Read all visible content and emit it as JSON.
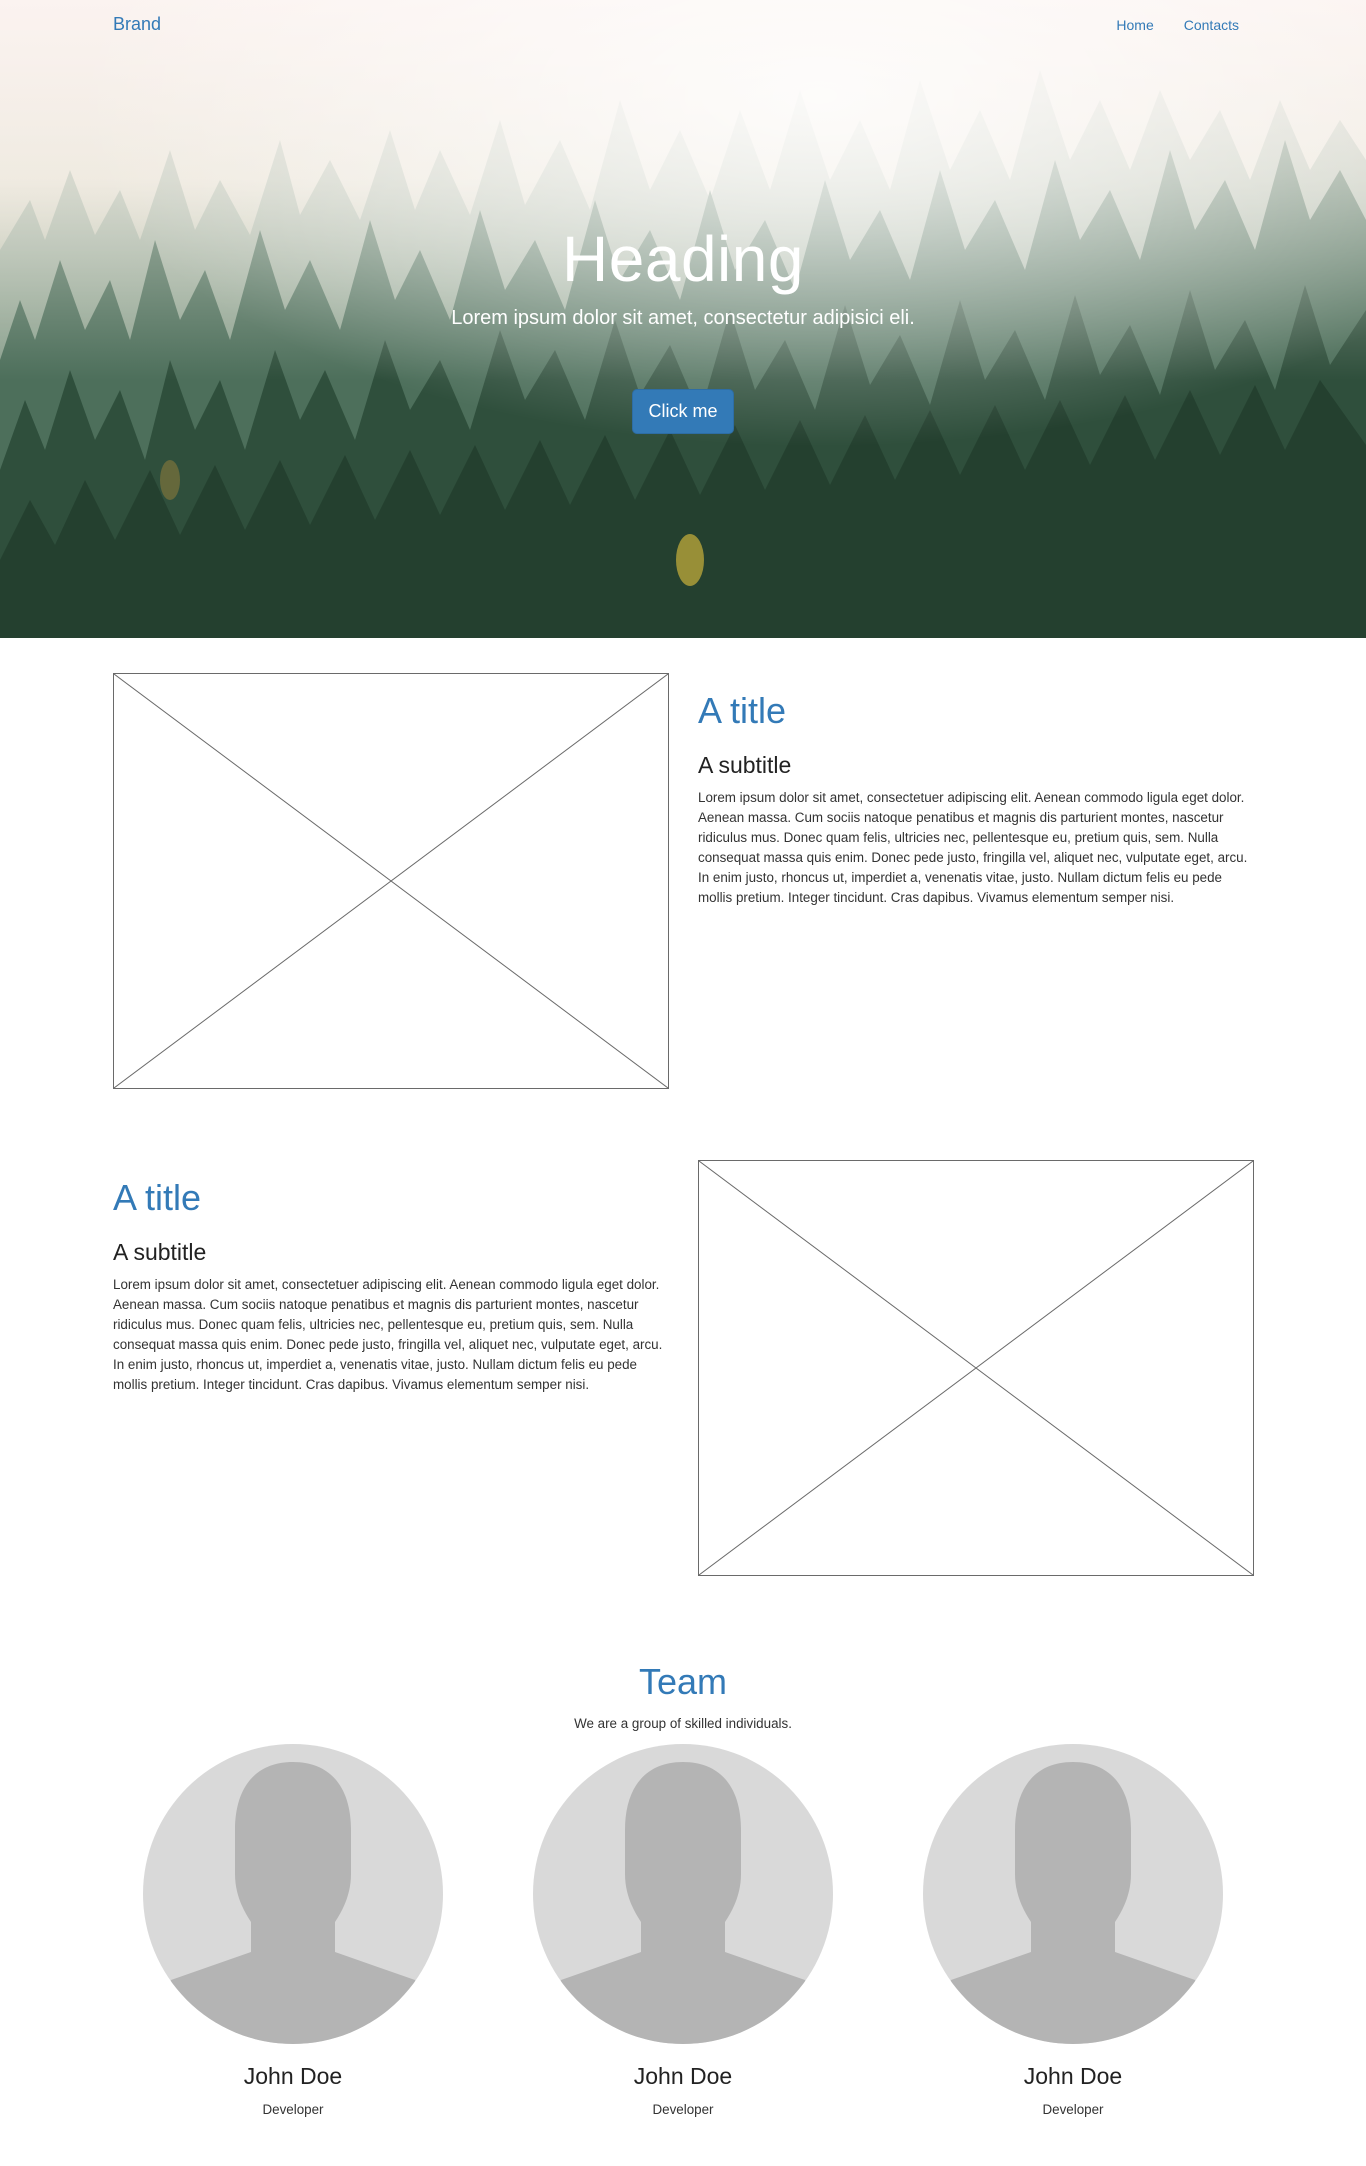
{
  "nav": {
    "brand": "Brand",
    "links": [
      "Home",
      "Contacts"
    ]
  },
  "hero": {
    "heading": "Heading",
    "subheading": "Lorem ipsum dolor sit amet, consectetur adipisici eli.",
    "button_label": "Click me"
  },
  "features": [
    {
      "title": "A title",
      "subtitle": "A subtitle",
      "text": "Lorem ipsum dolor sit amet, consectetuer adipiscing elit. Aenean commodo ligula eget dolor. Aenean massa. Cum sociis natoque penatibus et magnis dis parturient montes, nascetur ridiculus mus. Donec quam felis, ultricies nec, pellentesque eu, pretium quis, sem. Nulla consequat massa quis enim. Donec pede justo, fringilla vel, aliquet nec, vulputate eget, arcu. In enim justo, rhoncus ut, imperdiet a, venenatis vitae, justo. Nullam dictum felis eu pede mollis pretium. Integer tincidunt. Cras dapibus. Vivamus elementum semper nisi."
    },
    {
      "title": "A title",
      "subtitle": "A subtitle",
      "text": "Lorem ipsum dolor sit amet, consectetuer adipiscing elit. Aenean commodo ligula eget dolor. Aenean massa. Cum sociis natoque penatibus et magnis dis parturient montes, nascetur ridiculus mus. Donec quam felis, ultricies nec, pellentesque eu, pretium quis, sem. Nulla consequat massa quis enim. Donec pede justo, fringilla vel, aliquet nec, vulputate eget, arcu. In enim justo, rhoncus ut, imperdiet a, venenatis vitae, justo. Nullam dictum felis eu pede mollis pretium. Integer tincidunt. Cras dapibus. Vivamus elementum semper nisi."
    }
  ],
  "team": {
    "title": "Team",
    "subtitle": "We are a group of skilled individuals.",
    "members": [
      {
        "name": "John Doe",
        "role": "Developer"
      },
      {
        "name": "John Doe",
        "role": "Developer"
      },
      {
        "name": "John Doe",
        "role": "Developer"
      }
    ]
  },
  "colors": {
    "accent": "#337ab7",
    "avatar_bg": "#d9d9d9",
    "avatar_silhouette": "#b4b4b4"
  },
  "icons": {
    "image_placeholder": "image-placeholder-icon",
    "avatar": "user-silhouette-icon"
  }
}
